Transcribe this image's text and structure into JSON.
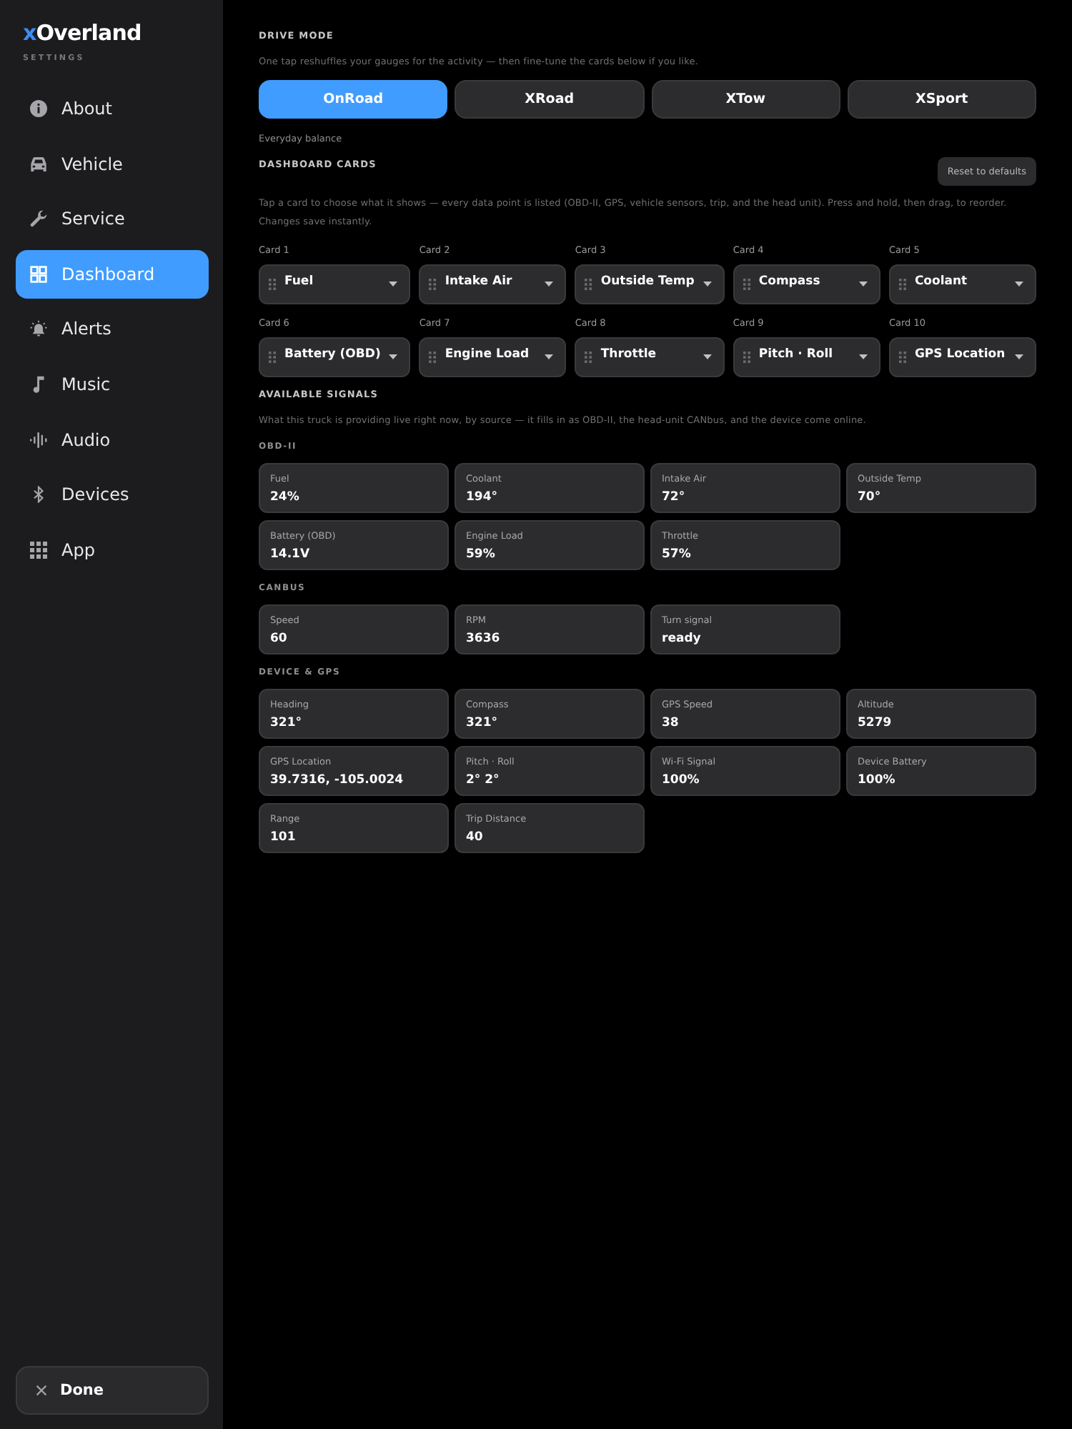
{
  "sidebar": {
    "logo": {
      "accent": "x",
      "text": "Overland"
    },
    "subtitle": "SETTINGS",
    "items": [
      {
        "label": "About",
        "selected": false
      },
      {
        "label": "Vehicle",
        "selected": false
      },
      {
        "label": "Service",
        "selected": false
      },
      {
        "label": "Dashboard",
        "selected": true
      },
      {
        "label": "Alerts",
        "selected": false
      },
      {
        "label": "Music",
        "selected": false
      },
      {
        "label": "Audio",
        "selected": false
      },
      {
        "label": "Devices",
        "selected": false
      },
      {
        "label": "App",
        "selected": false
      }
    ],
    "done_button": "Done"
  },
  "drive_mode": {
    "title": "DRIVE MODE",
    "description": "One tap reshuffles your gauges for the activity — then fine-tune the cards below if you like.",
    "modes": [
      {
        "label": "OnRoad",
        "selected": true
      },
      {
        "label": "XRoad",
        "selected": false
      },
      {
        "label": "XTow",
        "selected": false
      },
      {
        "label": "XSport",
        "selected": false
      }
    ],
    "hint": "Everyday balance"
  },
  "dashboard_cards": {
    "title": "DASHBOARD CARDS",
    "reset_button": "Reset to defaults",
    "description": "Tap a card to choose what it shows — every data point is listed (OBD-II, GPS, vehicle sensors, trip, and the head unit). Press and hold, then drag, to reorder. Changes save instantly.",
    "cards": [
      {
        "label": "Card 1",
        "value": "Fuel"
      },
      {
        "label": "Card 2",
        "value": "Intake Air"
      },
      {
        "label": "Card 3",
        "value": "Outside Temp"
      },
      {
        "label": "Card 4",
        "value": "Compass"
      },
      {
        "label": "Card 5",
        "value": "Coolant"
      },
      {
        "label": "Card 6",
        "value": "Battery (OBD)"
      },
      {
        "label": "Card 7",
        "value": "Engine Load"
      },
      {
        "label": "Card 8",
        "value": "Throttle"
      },
      {
        "label": "Card 9",
        "value": "Pitch · Roll"
      },
      {
        "label": "Card 10",
        "value": "GPS Location"
      }
    ]
  },
  "available_signals": {
    "title": "AVAILABLE SIGNALS",
    "description": "What this truck is providing live right now, by source — it fills in as OBD-II, the head-unit CANbus, and the device come online.",
    "groups": [
      {
        "title": "OBD-II",
        "signals": [
          {
            "label": "Fuel",
            "value": "24%"
          },
          {
            "label": "Coolant",
            "value": "194°"
          },
          {
            "label": "Intake Air",
            "value": "72°"
          },
          {
            "label": "Outside Temp",
            "value": "70°"
          },
          {
            "label": "Battery (OBD)",
            "value": "14.1V"
          },
          {
            "label": "Engine Load",
            "value": "59%"
          },
          {
            "label": "Throttle",
            "value": "57%"
          }
        ]
      },
      {
        "title": "CANBUS",
        "signals": [
          {
            "label": "Speed",
            "value": "60"
          },
          {
            "label": "RPM",
            "value": "3636"
          },
          {
            "label": "Turn signal",
            "value": "ready"
          }
        ]
      },
      {
        "title": "DEVICE & GPS",
        "signals": [
          {
            "label": "Heading",
            "value": "321°"
          },
          {
            "label": "Compass",
            "value": "321°"
          },
          {
            "label": "GPS Speed",
            "value": "38"
          },
          {
            "label": "Altitude",
            "value": "5279"
          },
          {
            "label": "GPS Location",
            "value": "39.7316, -105.0024"
          },
          {
            "label": "Pitch · Roll",
            "value": "2° 2°"
          },
          {
            "label": "Wi-Fi Signal",
            "value": "100%"
          },
          {
            "label": "Device Battery",
            "value": "100%"
          },
          {
            "label": "Range",
            "value": "101"
          },
          {
            "label": "Trip Distance",
            "value": "40"
          }
        ]
      }
    ]
  }
}
